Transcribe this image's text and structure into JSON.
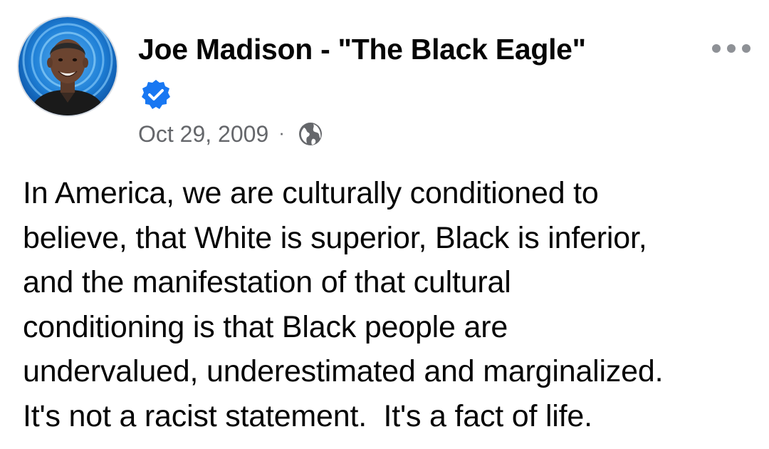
{
  "post": {
    "author": {
      "name": "Joe Madison - \"The Black Eagle\"",
      "avatar_icon": "profile-photo",
      "verified": true,
      "verified_icon": "verified-badge-icon",
      "verified_color": "#1877f2"
    },
    "date": "Oct 29, 2009",
    "separator": "·",
    "audience_icon": "globe-icon",
    "more_icon": "more-options-icon",
    "text_lines": [
      "In America, we are culturally conditioned to",
      "believe, that White is superior, Black is inferior,",
      "and the manifestation of that cultural",
      "conditioning is that Black people are",
      "undervalued, underestimated and marginalized.",
      "It's not a racist statement.  It's a fact of life."
    ]
  },
  "colors": {
    "text_primary": "#050505",
    "text_secondary": "#65676b",
    "accent_blue": "#1877f2",
    "background": "#ffffff"
  }
}
